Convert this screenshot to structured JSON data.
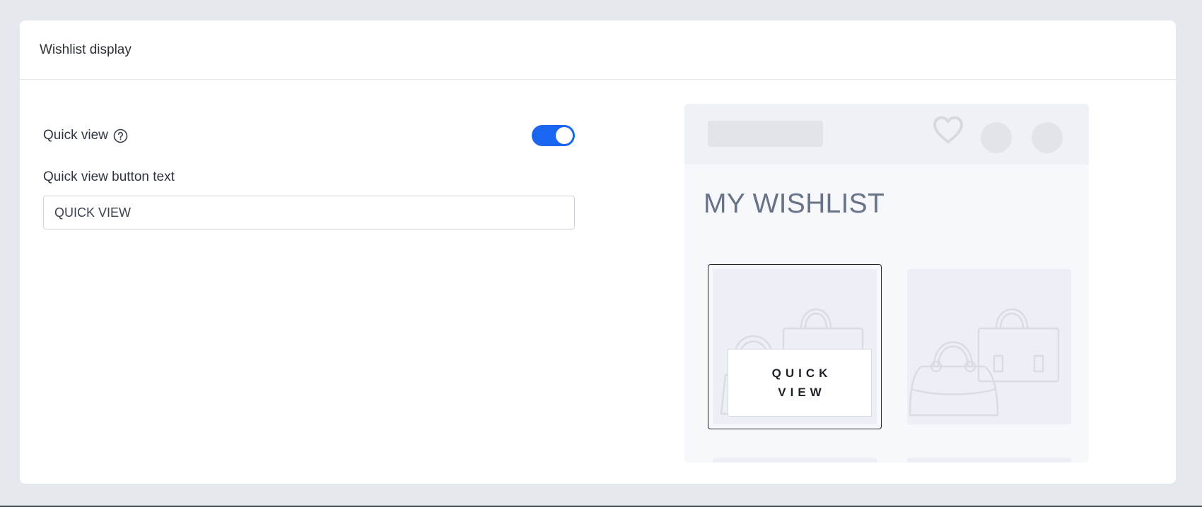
{
  "section": {
    "title": "Wishlist display"
  },
  "settings": {
    "quick_view_label": "Quick view",
    "quick_view_enabled": true,
    "button_text_label": "Quick view button text",
    "button_text_value": "QUICK VIEW"
  },
  "preview": {
    "heading": "MY WISHLIST",
    "quick_view_button_text": "QUICK VIEW",
    "icons": {
      "header": "heart-icon",
      "help": "question-circle-icon",
      "product": "handbag-icon"
    },
    "colors": {
      "accent": "#1a66f0",
      "heading": "#697388"
    }
  }
}
